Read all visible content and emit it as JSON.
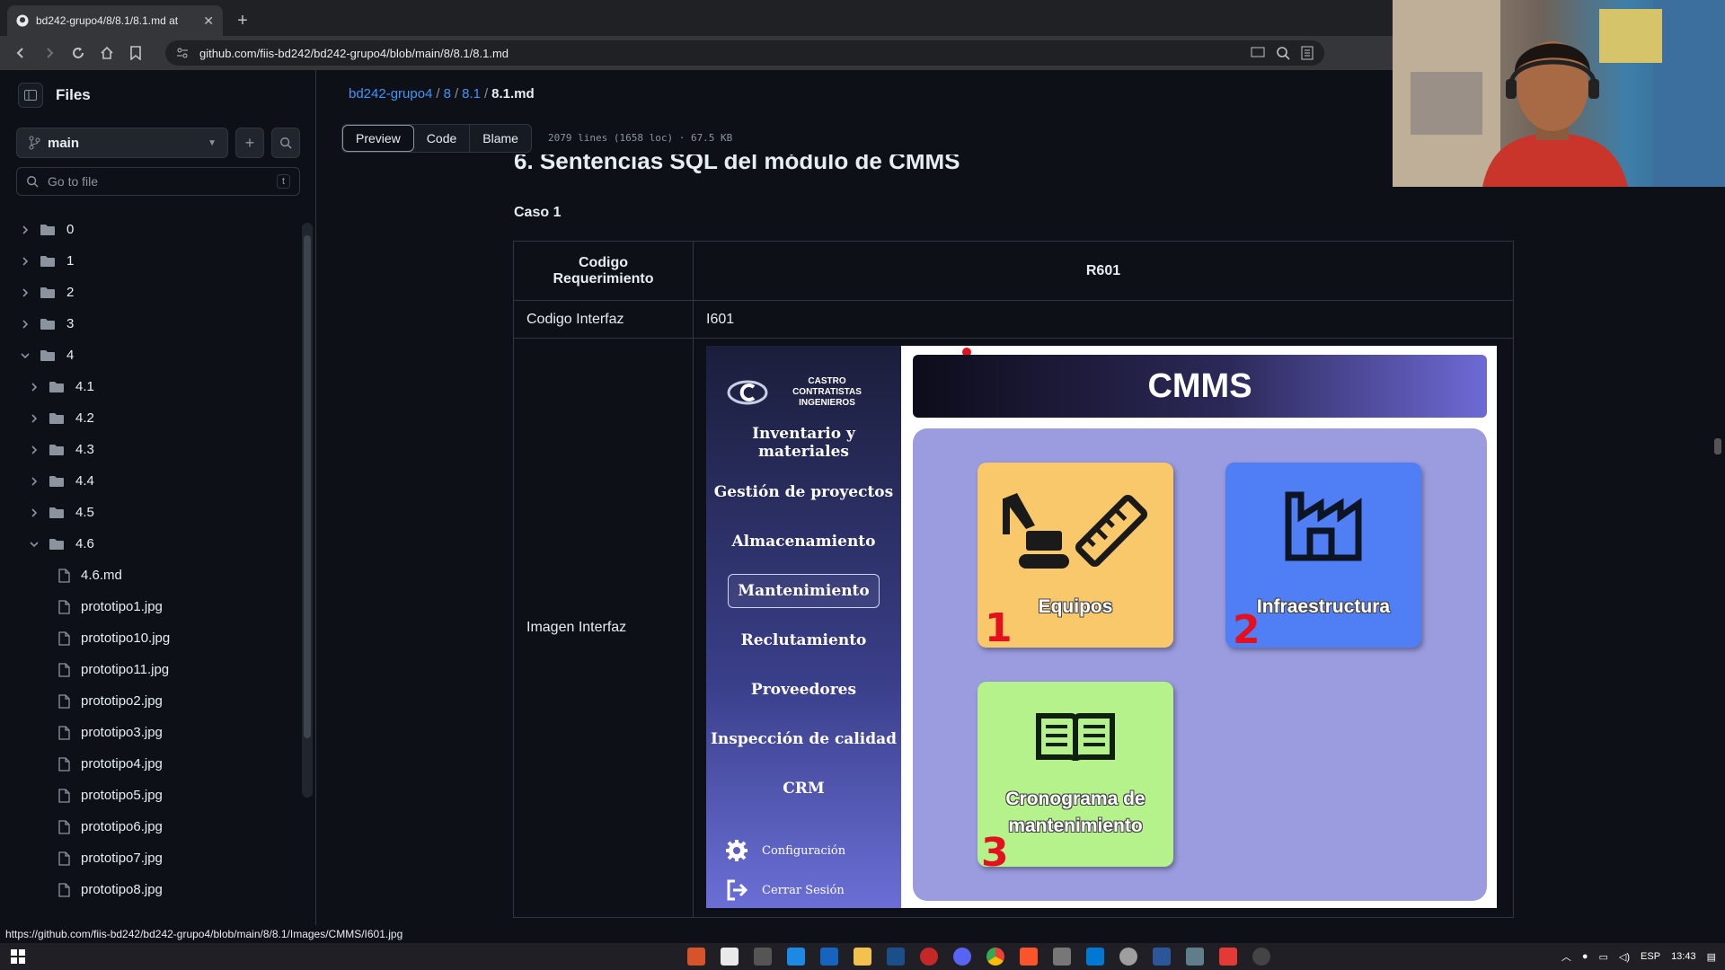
{
  "browser": {
    "tab_title": "bd242-grupo4/8/8.1/8.1.md at",
    "url": "github.com/fiis-bd242/bd242-grupo4/blob/main/8/8.1/8.1.md"
  },
  "sidebar": {
    "title": "Files",
    "branch": "main",
    "search_placeholder": "Go to file",
    "search_shortcut": "t",
    "tree": [
      {
        "name": "0",
        "type": "folder",
        "depth": 0,
        "open": false
      },
      {
        "name": "1",
        "type": "folder",
        "depth": 0,
        "open": false
      },
      {
        "name": "2",
        "type": "folder",
        "depth": 0,
        "open": false
      },
      {
        "name": "3",
        "type": "folder",
        "depth": 0,
        "open": false
      },
      {
        "name": "4",
        "type": "folder",
        "depth": 0,
        "open": true
      },
      {
        "name": "4.1",
        "type": "folder",
        "depth": 1,
        "open": false
      },
      {
        "name": "4.2",
        "type": "folder",
        "depth": 1,
        "open": false
      },
      {
        "name": "4.3",
        "type": "folder",
        "depth": 1,
        "open": false
      },
      {
        "name": "4.4",
        "type": "folder",
        "depth": 1,
        "open": false
      },
      {
        "name": "4.5",
        "type": "folder",
        "depth": 1,
        "open": false
      },
      {
        "name": "4.6",
        "type": "folder",
        "depth": 1,
        "open": true
      },
      {
        "name": "4.6.md",
        "type": "file",
        "depth": 2
      },
      {
        "name": "prototipo1.jpg",
        "type": "file",
        "depth": 2
      },
      {
        "name": "prototipo10.jpg",
        "type": "file",
        "depth": 2
      },
      {
        "name": "prototipo11.jpg",
        "type": "file",
        "depth": 2
      },
      {
        "name": "prototipo2.jpg",
        "type": "file",
        "depth": 2
      },
      {
        "name": "prototipo3.jpg",
        "type": "file",
        "depth": 2
      },
      {
        "name": "prototipo4.jpg",
        "type": "file",
        "depth": 2
      },
      {
        "name": "prototipo5.jpg",
        "type": "file",
        "depth": 2
      },
      {
        "name": "prototipo6.jpg",
        "type": "file",
        "depth": 2
      },
      {
        "name": "prototipo7.jpg",
        "type": "file",
        "depth": 2
      },
      {
        "name": "prototipo8.jpg",
        "type": "file",
        "depth": 2
      }
    ]
  },
  "breadcrumb": {
    "repo": "bd242-grupo4",
    "dir1": "8",
    "dir2": "8.1",
    "file": "8.1.md"
  },
  "view_tabs": [
    "Preview",
    "Code",
    "Blame"
  ],
  "file_info": "2079 lines (1658 loc) · 67.5 KB",
  "doc": {
    "heading": "6. Sentencias SQL del módulo de CMMS",
    "caso": "Caso 1",
    "rows": [
      {
        "key": "Codigo Requerimiento",
        "value": "R601"
      },
      {
        "key": "Codigo Interfaz",
        "value": "I601"
      },
      {
        "key": "Imagen Interfaz"
      }
    ]
  },
  "cmms_image": {
    "brand": "CASTRO CONTRATISTAS INGENIEROS",
    "menu": [
      "Inventario y materiales",
      "Gestión de proyectos",
      "Almacenamiento",
      "Mantenimiento",
      "Reclutamiento",
      "Proveedores",
      "Inspección de calidad",
      "CRM"
    ],
    "selected_menu": "Mantenimiento",
    "bottom": [
      "Configuración",
      "Cerrar Sesión"
    ],
    "banner": "CMMS",
    "cards": [
      {
        "label": "Equipos",
        "number": "1",
        "color": "#f9c86b",
        "icon": "excavator-ruler-icon"
      },
      {
        "label": "Infraestructura",
        "number": "2",
        "color": "#4f7ef5",
        "icon": "factory-icon"
      },
      {
        "label": "Cronograma de mantenimiento",
        "number": "3",
        "color": "#b6f28c",
        "icon": "book-icon"
      }
    ]
  },
  "status_url": "https://github.com/fiis-bd242/bd242-grupo4/blob/main/8/8.1/Images/CMMS/I601.jpg",
  "taskbar": {
    "lang": "ESP",
    "time": "13:43"
  },
  "colors": {
    "link": "#4493f8",
    "accent_red": "#e3101e"
  }
}
